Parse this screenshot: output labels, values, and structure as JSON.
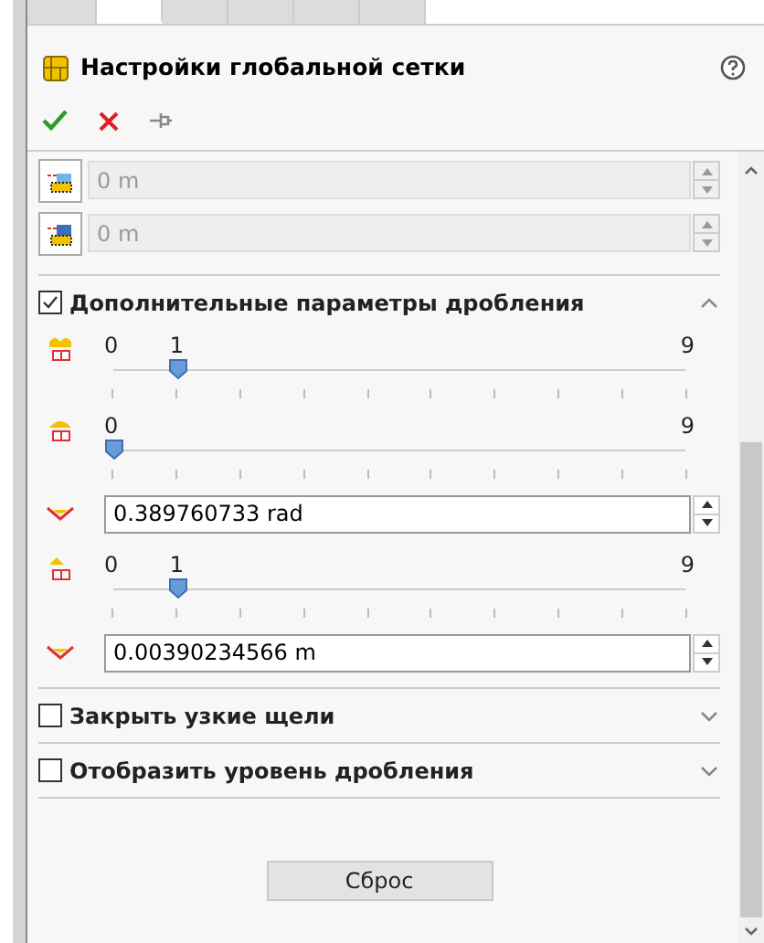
{
  "tabs": [
    {
      "selected": false
    },
    {
      "selected": true
    },
    {
      "selected": false
    },
    {
      "selected": false
    },
    {
      "selected": false
    },
    {
      "selected": false
    }
  ],
  "title": "Настройки глобальной сетки",
  "top_fields": [
    {
      "value": "0 m",
      "disabled": true
    },
    {
      "value": "0 m",
      "disabled": true
    }
  ],
  "sections": [
    {
      "label": "Дополнительные параметры дробления",
      "checked": true,
      "expanded": true,
      "items": [
        {
          "kind": "slider",
          "min_label": "0",
          "value_label": "1",
          "max_label": "9",
          "level": 0.111
        },
        {
          "kind": "slider",
          "min_label": "0",
          "max_label": "9",
          "level": 0
        },
        {
          "kind": "field",
          "value": "0.389760733 rad",
          "disabled": false
        },
        {
          "kind": "slider",
          "min_label": "0",
          "value_label": "1",
          "max_label": "9",
          "level": 0.111
        },
        {
          "kind": "field",
          "value": "0.00390234566 m",
          "disabled": false
        }
      ]
    },
    {
      "label": "Закрыть узкие щели",
      "checked": false,
      "expanded": false
    },
    {
      "label": "Отобразить уровень дробления",
      "checked": false,
      "expanded": false
    }
  ],
  "reset_button": "Сброс"
}
